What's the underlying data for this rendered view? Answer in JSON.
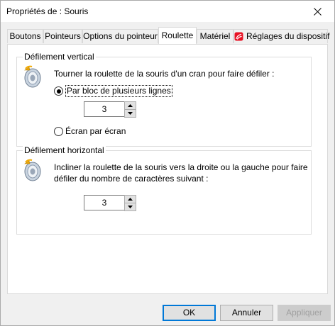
{
  "window": {
    "title": "Propriétés de : Souris"
  },
  "tabs": [
    {
      "label": "Boutons"
    },
    {
      "label": "Pointeurs"
    },
    {
      "label": "Options du pointeur"
    },
    {
      "label": "Roulette"
    },
    {
      "label": "Matériel"
    },
    {
      "label": "Réglages du dispositif"
    }
  ],
  "active_tab": "Roulette",
  "vertical": {
    "legend": "Défilement vertical",
    "description": "Tourner la roulette de la souris d'un cran pour faire défiler :",
    "option_lines": "Par bloc de plusieurs lignes",
    "lines_value": "3",
    "option_screen": "Écran par écran",
    "selected": "option_lines"
  },
  "horizontal": {
    "legend": "Défilement horizontal",
    "description_line1": "Incliner la roulette de la souris vers la droite ou la gauche pour faire",
    "description_line2": "défiler du nombre de caractères suivant :",
    "chars_value": "3"
  },
  "buttons": {
    "ok": "OK",
    "cancel": "Annuler",
    "apply": "Appliquer"
  },
  "colors": {
    "accent": "#0078d7",
    "device_icon": "#e81123"
  },
  "icons": {
    "close": "close-icon",
    "wheel": "mouse-wheel-icon",
    "device": "synaptics-device-icon",
    "spin_up": "arrow-up-icon",
    "spin_down": "arrow-down-icon"
  }
}
